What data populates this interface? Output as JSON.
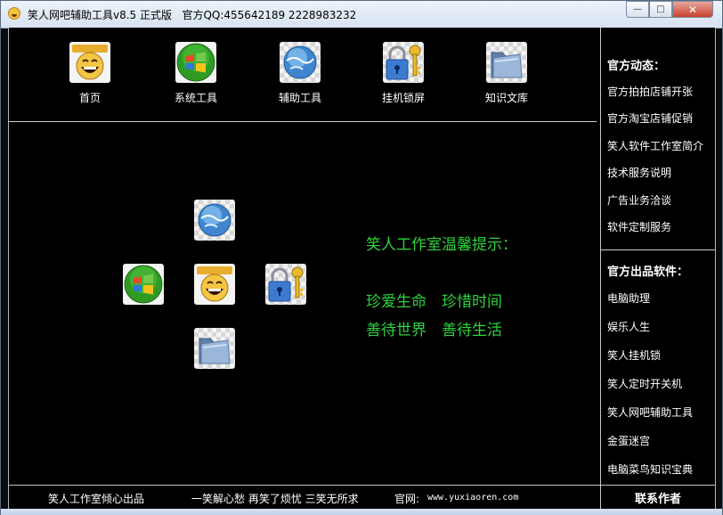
{
  "window": {
    "title": "笑人网吧辅助工具v8.5 正式版",
    "qq": "官方QQ:455642189 2228983232",
    "buttons": {
      "minimize": "—",
      "maximize": "□",
      "close": "✕"
    }
  },
  "toolbar": [
    {
      "label": "首页",
      "icon": "smiley-face-icon"
    },
    {
      "label": "系统工具",
      "icon": "windows-logo-icon"
    },
    {
      "label": "辅助工具",
      "icon": "globe-icon"
    },
    {
      "label": "挂机锁屏",
      "icon": "padlock-key-icon"
    },
    {
      "label": "知识文库",
      "icon": "folder-icon"
    }
  ],
  "center": {
    "icons": [
      "globe-icon",
      "windows-logo-icon",
      "smiley-face-icon",
      "padlock-key-icon",
      "folder-icon"
    ],
    "tip_title": "笑人工作室温馨提示：",
    "tip_line1": "珍爱生命　珍惜时间",
    "tip_line2": "善待世界　善待生活",
    "tip_color": "#2fd33b"
  },
  "sidebar": {
    "news_header": "官方动态：",
    "news": [
      "官方拍拍店铺开张",
      "官方淘宝店铺促销",
      "笑人软件工作室简介",
      "技术服务说明",
      "广告业务洽谈",
      "软件定制服务"
    ],
    "products_header": "官方出品软件：",
    "products": [
      "电脑助理",
      "娱乐人生",
      "笑人挂机锁",
      "笑人定时开关机",
      "笑人网吧辅助工具",
      "金蛋迷宫",
      "电脑菜鸟知识宝典"
    ]
  },
  "status": {
    "credit": "笑人工作室倾心出品",
    "slogan": "一笑解心愁 再笑了烦忧 三笑无所求",
    "site_label": "官网:",
    "site": "www.yuxiaoren.com",
    "contact": "联系作者"
  }
}
